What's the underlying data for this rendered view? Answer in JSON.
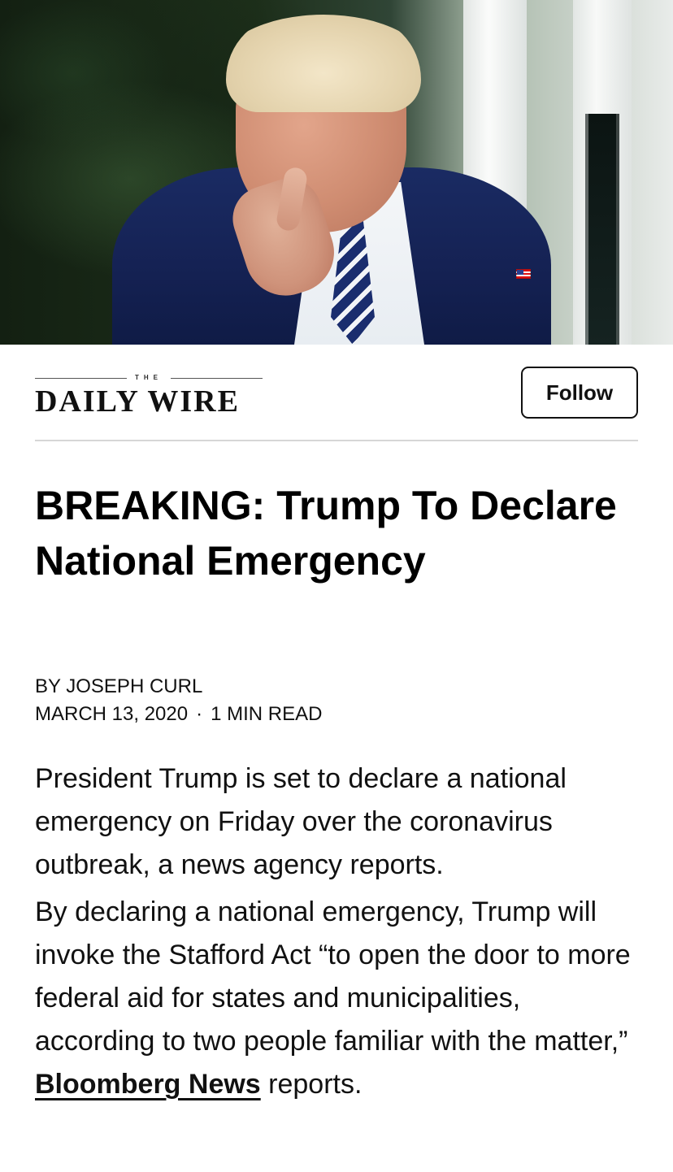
{
  "hero": {
    "image_alt": "Donald Trump pointing at the camera"
  },
  "header": {
    "brand_small": "THE",
    "brand_name": "DAILY WIRE",
    "follow_label": "Follow"
  },
  "article": {
    "headline": "BREAKING: Trump To Declare National Emergency",
    "byline": "BY JOSEPH CURL",
    "date": "MARCH 13, 2020",
    "dot": "·",
    "read_time": "1 MIN READ",
    "paragraphs": [
      "President Trump is set to declare a national emergency on Friday over the coronavirus outbreak, a news agency reports.",
      {
        "pre": "By declaring a national emergency, Trump will invoke the Stafford Act “to open the door to more federal aid for states and municipalities, according to two people familiar with the matter,”",
        "link_text": "Bloomberg News",
        "post": " reports."
      }
    ]
  }
}
